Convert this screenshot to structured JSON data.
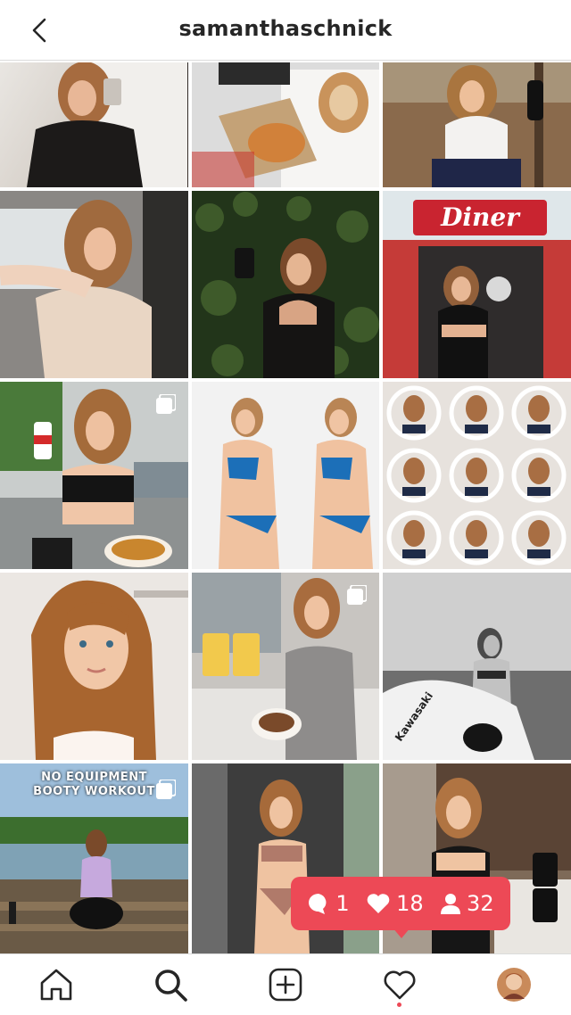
{
  "header": {
    "username": "samanthaschnick",
    "back_icon": "chevron-left-icon"
  },
  "grid": {
    "tiles": [
      {
        "id": "post-1",
        "desc": "mirror selfie",
        "multi": false
      },
      {
        "id": "post-2",
        "desc": "bagel and pastry",
        "multi": false
      },
      {
        "id": "post-3",
        "desc": "outdoor with bottle",
        "multi": false
      },
      {
        "id": "post-4",
        "desc": "car selfie",
        "multi": false
      },
      {
        "id": "post-5",
        "desc": "ivy wall with product",
        "multi": false
      },
      {
        "id": "post-6",
        "desc": "diner storefront",
        "multi": false
      },
      {
        "id": "post-7",
        "desc": "living room with drink",
        "multi": true
      },
      {
        "id": "post-8",
        "desc": "bikini side by side",
        "multi": false
      },
      {
        "id": "post-9",
        "desc": "ring light collage",
        "multi": false
      },
      {
        "id": "post-10",
        "desc": "portrait",
        "multi": false
      },
      {
        "id": "post-11",
        "desc": "kitchen with products",
        "multi": true
      },
      {
        "id": "post-12",
        "desc": "jet ski black and white",
        "multi": false
      },
      {
        "id": "post-13",
        "desc": "lake workout",
        "multi": true,
        "overlay": "NO EQUIPMENT\nBOOTY WORKOUT"
      },
      {
        "id": "post-14",
        "desc": "patio bikini",
        "multi": false
      },
      {
        "id": "post-15",
        "desc": "kitchen with EHPlabs",
        "multi": false
      }
    ],
    "overlay_line1": "NO EQUIPMENT",
    "overlay_line2": "BOOTY WORKOUT",
    "sign_diner": "Diner"
  },
  "activity": {
    "comments": "1",
    "likes": "18",
    "follows": "32",
    "color": "#ed4956"
  },
  "tabs": [
    {
      "name": "home-icon"
    },
    {
      "name": "search-icon"
    },
    {
      "name": "new-post-icon"
    },
    {
      "name": "activity-heart-icon"
    },
    {
      "name": "profile-avatar"
    }
  ]
}
